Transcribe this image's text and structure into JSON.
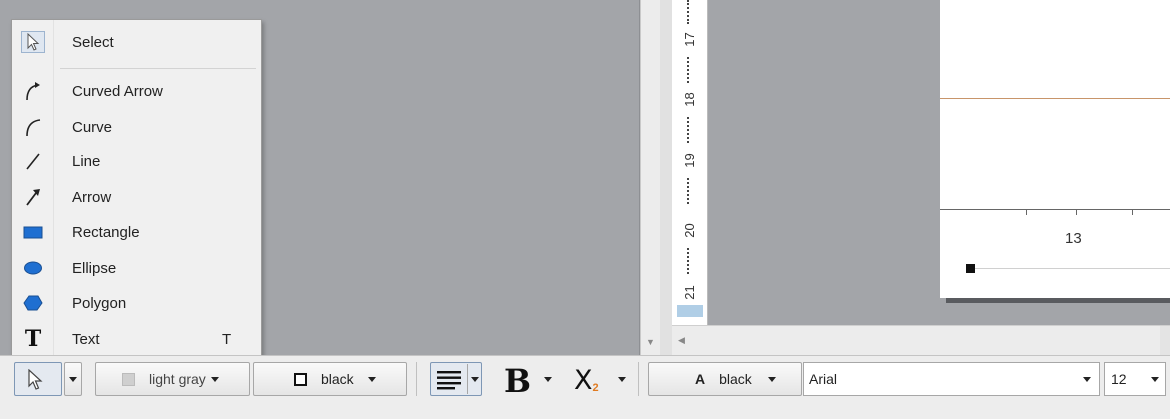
{
  "menu": {
    "items": [
      {
        "label": "Select",
        "icon": "cursor-arrow-icon",
        "shortcut": ""
      },
      {
        "label": "Curved Arrow",
        "icon": "curved-arrow-icon",
        "shortcut": ""
      },
      {
        "label": "Curve",
        "icon": "curve-icon",
        "shortcut": ""
      },
      {
        "label": "Line",
        "icon": "line-icon",
        "shortcut": ""
      },
      {
        "label": "Arrow",
        "icon": "arrow-icon",
        "shortcut": ""
      },
      {
        "label": "Rectangle",
        "icon": "rectangle-icon",
        "shortcut": ""
      },
      {
        "label": "Ellipse",
        "icon": "ellipse-icon",
        "shortcut": ""
      },
      {
        "label": "Polygon",
        "icon": "polygon-icon",
        "shortcut": ""
      },
      {
        "label": "Text",
        "icon": "text-icon",
        "shortcut": "T"
      }
    ]
  },
  "ruler": {
    "ticks": [
      "17",
      "18",
      "19",
      "20",
      "21"
    ]
  },
  "page": {
    "axis_label": "13"
  },
  "toolbar": {
    "fill_color": "light gray",
    "line_color": "black",
    "bold_glyph": "B",
    "subscript_glyph": "X",
    "subscript_small": "2",
    "font_color_glyph": "A",
    "font_color": "black",
    "font_name": "Arial",
    "font_size": "12"
  },
  "colors": {
    "canvas": "#a3a5a9",
    "shape_fill": "#1f6fd1",
    "guide_line": "#c8956a",
    "subscript_accent": "#e07b22"
  }
}
